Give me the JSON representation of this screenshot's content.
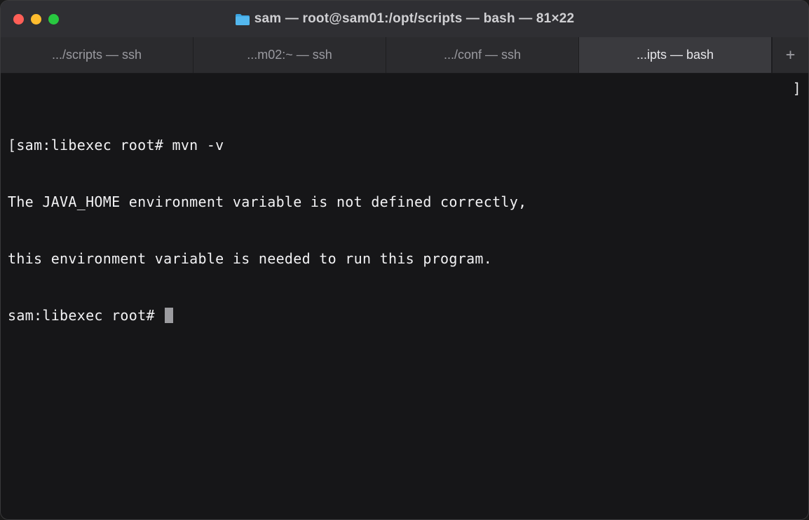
{
  "window": {
    "title": "sam — root@sam01:/opt/scripts — bash — 81×22"
  },
  "tabs": [
    {
      "label": ".../scripts — ssh",
      "active": false
    },
    {
      "label": "...m02:~ — ssh",
      "active": false
    },
    {
      "label": ".../conf — ssh",
      "active": false
    },
    {
      "label": "...ipts — bash",
      "active": true
    }
  ],
  "newtab_glyph": "+",
  "terminal": {
    "left_bracket": "[",
    "right_bracket": "]",
    "lines": [
      "sam:libexec root# mvn -v",
      "The JAVA_HOME environment variable is not defined correctly,",
      "this environment variable is needed to run this program.",
      "sam:libexec root# "
    ]
  }
}
